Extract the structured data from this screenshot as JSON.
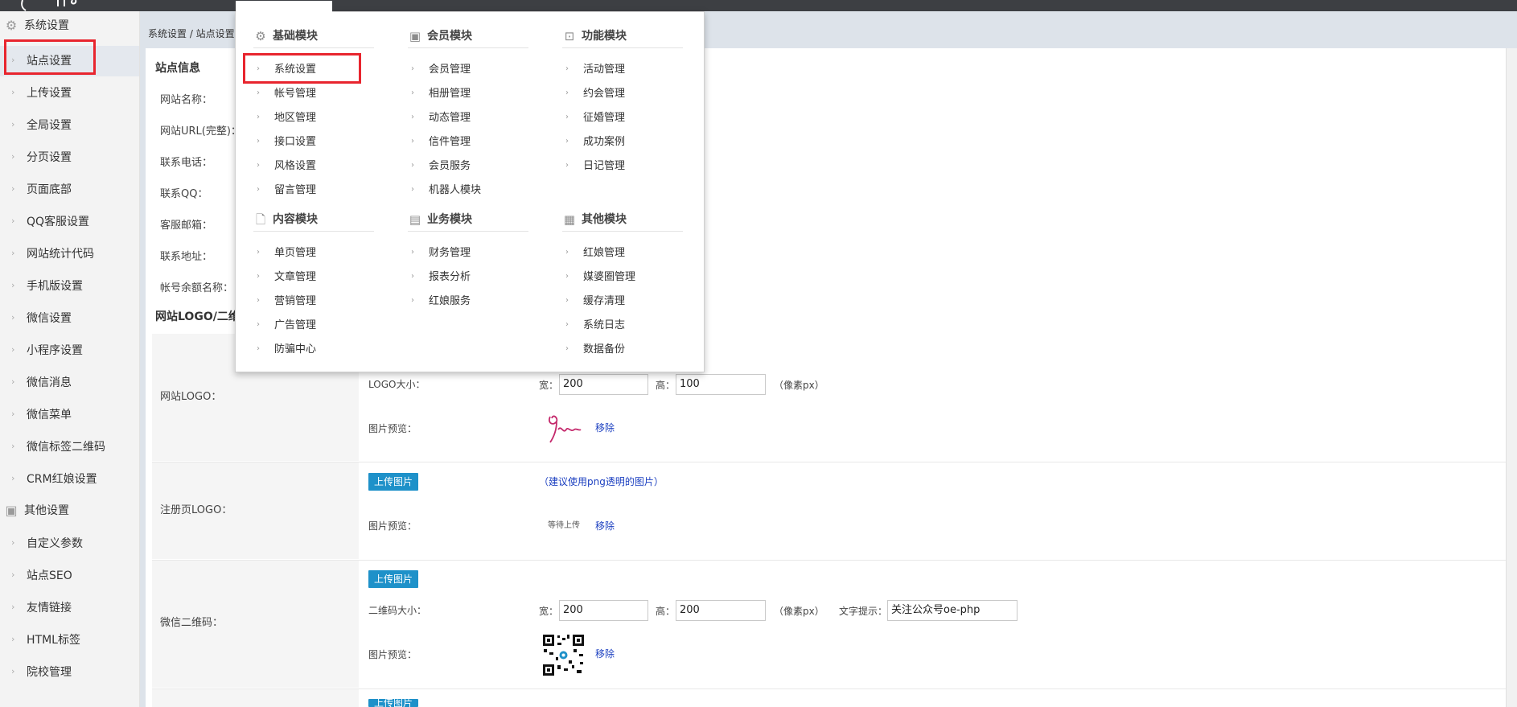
{
  "sidebar": {
    "group_system": "系统设置",
    "items_system": [
      "站点设置",
      "上传设置",
      "全局设置",
      "分页设置",
      "页面底部",
      "QQ客服设置",
      "网站统计代码",
      "手机版设置",
      "微信设置",
      "小程序设置",
      "微信消息",
      "微信菜单",
      "微信标签二维码",
      "CRM红娘设置"
    ],
    "group_other": "其他设置",
    "items_other": [
      "自定义参数",
      "站点SEO",
      "友情链接",
      "HTML标签",
      "院校管理"
    ]
  },
  "breadcrumb": "系统设置 / 站点设置",
  "site_info": {
    "title": "站点信息",
    "labels": [
      "网站名称：",
      "网站URL(完整)：",
      "联系电话：",
      "联系QQ：",
      "客服邮箱：",
      "联系地址：",
      "帐号余额名称："
    ]
  },
  "logo_section": {
    "title": "网站LOGO/二维",
    "site_logo": {
      "label": "网站LOGO：",
      "size_label": "LOGO大小：",
      "width_label": "宽：",
      "width_value": "200",
      "height_label": "高：",
      "height_value": "100",
      "unit": "（像素px）",
      "preview_label": "图片预览：",
      "remove": "移除"
    },
    "register_logo": {
      "label": "注册页LOGO：",
      "upload": "上传图片",
      "hint": "（建议使用png透明的图片）",
      "preview_label": "图片预览：",
      "placeholder": "等待上传",
      "remove": "移除"
    },
    "wechat_qr": {
      "label": "微信二维码：",
      "upload": "上传图片",
      "size_label": "二维码大小：",
      "width_label": "宽：",
      "width_value": "200",
      "height_label": "高：",
      "height_value": "200",
      "unit": "（像素px）",
      "text_hint_label": "文字提示：",
      "text_hint_value": "关注公众号oe-php",
      "preview_label": "图片预览：",
      "remove": "移除"
    },
    "next_upload": "上传图片"
  },
  "menu": {
    "columns": [
      {
        "sections": [
          {
            "title": "基础模块",
            "icon": "gear-icon",
            "items": [
              "系统设置",
              "帐号管理",
              "地区管理",
              "接口设置",
              "风格设置",
              "留言管理"
            ]
          },
          {
            "title": "内容模块",
            "icon": "document-icon",
            "items": [
              "单页管理",
              "文章管理",
              "营销管理",
              "广告管理",
              "防骗中心"
            ]
          }
        ]
      },
      {
        "sections": [
          {
            "title": "会员模块",
            "icon": "user-card-icon",
            "items": [
              "会员管理",
              "相册管理",
              "动态管理",
              "信件管理",
              "会员服务",
              "机器人模块"
            ]
          },
          {
            "title": "业务模块",
            "icon": "business-icon",
            "items": [
              "财务管理",
              "报表分析",
              "红娘服务"
            ]
          }
        ]
      },
      {
        "sections": [
          {
            "title": "功能模块",
            "icon": "function-icon",
            "items": [
              "活动管理",
              "约会管理",
              "征婚管理",
              "成功案例",
              "日记管理"
            ]
          },
          {
            "title": "其他模块",
            "icon": "grid-icon",
            "items": [
              "红娘管理",
              "媒婆圈管理",
              "缓存清理",
              "系统日志",
              "数据备份"
            ]
          }
        ]
      }
    ]
  },
  "colors": {
    "highlight": "#e8252e",
    "upload_button": "#1e91c9",
    "link": "#1b3fc0",
    "topbar": "#3d3f43"
  }
}
